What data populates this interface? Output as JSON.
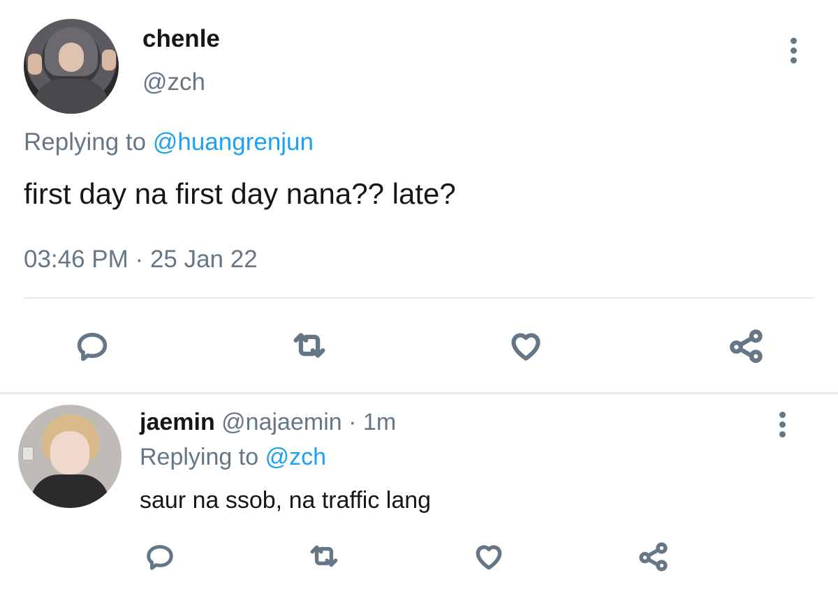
{
  "tweet": {
    "display_name": "chenle",
    "handle": "@zch",
    "replying_prefix": "Replying to",
    "replying_mention": "@huangrenjun",
    "text": "first day na first day nana?? late?",
    "time": "03:46 PM",
    "separator": "·",
    "date": "25 Jan 22"
  },
  "reply": {
    "display_name": "jaemin",
    "handle": "@najaemin",
    "separator": "·",
    "age": "1m",
    "replying_prefix": "Replying to",
    "replying_mention": "@zch",
    "text": "saur na ssob, na traffic lang"
  },
  "icons": [
    "reply-icon",
    "retweet-icon",
    "like-icon",
    "share-icon",
    "more-icon"
  ],
  "colors": {
    "text": "#14171a",
    "secondary": "#657786",
    "link": "#1da1f2",
    "divider": "#e6ecf0"
  }
}
